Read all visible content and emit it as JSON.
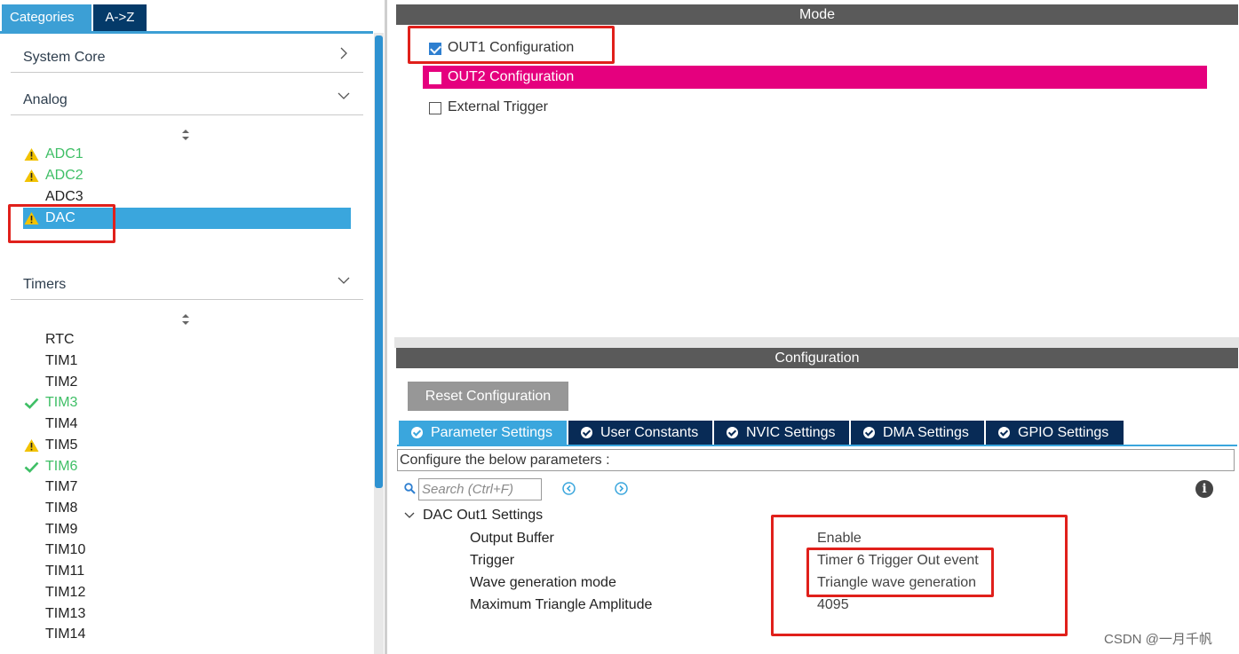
{
  "sidebar": {
    "tabs": [
      "Categories",
      "A->Z"
    ],
    "groups": {
      "system_core": "System Core",
      "analog": "Analog",
      "timers": "Timers"
    },
    "analog_items": [
      {
        "label": "ADC1",
        "status": "warning"
      },
      {
        "label": "ADC2",
        "status": "warning"
      },
      {
        "label": "ADC3",
        "status": "none"
      },
      {
        "label": "DAC",
        "status": "warning",
        "selected": true
      }
    ],
    "timer_items": [
      {
        "label": "RTC",
        "status": "none"
      },
      {
        "label": "TIM1",
        "status": "none"
      },
      {
        "label": "TIM2",
        "status": "none"
      },
      {
        "label": "TIM3",
        "status": "ok"
      },
      {
        "label": "TIM4",
        "status": "none"
      },
      {
        "label": "TIM5",
        "status": "warning"
      },
      {
        "label": "TIM6",
        "status": "ok"
      },
      {
        "label": "TIM7",
        "status": "none"
      },
      {
        "label": "TIM8",
        "status": "none"
      },
      {
        "label": "TIM9",
        "status": "none"
      },
      {
        "label": "TIM10",
        "status": "none"
      },
      {
        "label": "TIM11",
        "status": "none"
      },
      {
        "label": "TIM12",
        "status": "none"
      },
      {
        "label": "TIM13",
        "status": "none"
      },
      {
        "label": "TIM14",
        "status": "none"
      }
    ]
  },
  "mode": {
    "title": "Mode",
    "options": [
      {
        "label": "OUT1 Configuration",
        "checked": true
      },
      {
        "label": "OUT2 Configuration",
        "checked": false
      },
      {
        "label": "External Trigger",
        "checked": false
      }
    ]
  },
  "configuration": {
    "title": "Configuration",
    "reset_label": "Reset Configuration",
    "tabs": [
      "Parameter Settings",
      "User Constants",
      "NVIC Settings",
      "DMA Settings",
      "GPIO Settings"
    ],
    "prompt": "Configure the below parameters :",
    "search_placeholder": "Search (Ctrl+F)",
    "section_title": "DAC Out1 Settings",
    "params": [
      {
        "name": "Output Buffer",
        "value": "Enable"
      },
      {
        "name": "Trigger",
        "value": "Timer 6 Trigger Out event"
      },
      {
        "name": "Wave generation mode",
        "value": "Triangle wave generation"
      },
      {
        "name": "Maximum Triangle Amplitude",
        "value": "4095"
      }
    ]
  },
  "watermark": "CSDN @一月千帆",
  "colors": {
    "accent_blue": "#3aa6dd",
    "dark_navy": "#082b56",
    "magenta": "#e5007e",
    "ok_green": "#3fbf66",
    "warning_yellow": "#f2c200",
    "highlight_red": "#e0201b"
  }
}
